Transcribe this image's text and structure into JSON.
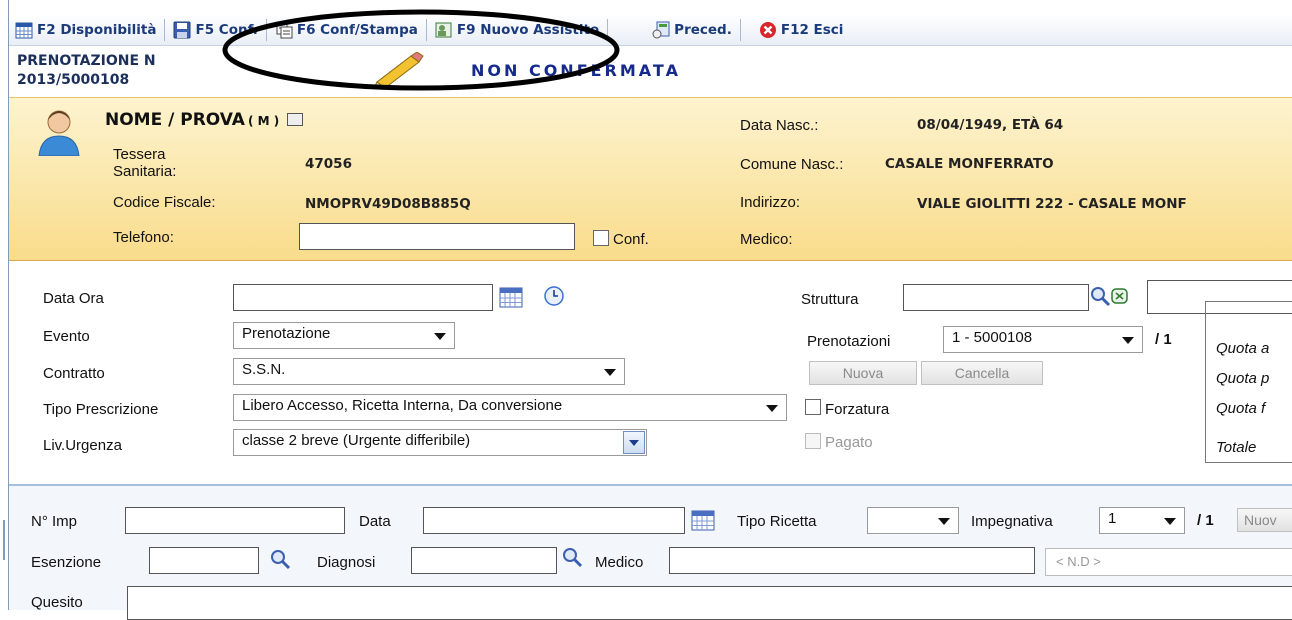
{
  "toolbar": {
    "disponibilita": "F2 Disponibilità",
    "conf": "F5 Conf.",
    "conf_stampa": "F6 Conf/Stampa",
    "nuovo_assistito": "F9 Nuovo Assistito",
    "preced": "Preced.",
    "esci": "F12 Esci"
  },
  "header": {
    "prenotazione_label": "PRENOTAZIONE N",
    "prenotazione_num": "2013/5000108",
    "stato": "NON CONFERMATA"
  },
  "patient": {
    "name": "NOME / PROVA",
    "sex": "( M )",
    "tessera_label_1": "Tessera",
    "tessera_label_2": "Sanitaria:",
    "tessera_value": "47056",
    "cf_label": "Codice Fiscale:",
    "cf_value": "NMOPRV49D08B885Q",
    "telefono_label": "Telefono:",
    "telefono_value": "",
    "conf_label": "Conf.",
    "data_nasc_label": "Data Nasc.:",
    "data_nasc_value": "08/04/1949, ETÀ 64",
    "comune_label": "Comune Nasc.:",
    "comune_value": "CASALE MONFERRATO",
    "indirizzo_label": "Indirizzo:",
    "indirizzo_value": "VIALE GIOLITTI 222  -  CASALE MONF",
    "medico_label": "Medico:"
  },
  "form": {
    "data_ora_label": "Data Ora",
    "data_ora_value": "",
    "evento_label": "Evento",
    "evento_value": "Prenotazione",
    "contratto_label": "Contratto",
    "contratto_value": "S.S.N.",
    "tipo_prescr_label": "Tipo Prescrizione",
    "tipo_prescr_value": "Libero Accesso, Ricetta Interna, Da conversione",
    "urgenza_label": "Liv.Urgenza",
    "urgenza_value": "classe 2 breve (Urgente differibile)",
    "struttura_label": "Struttura",
    "prenotazioni_label": "Prenotazioni",
    "prenotazioni_value": "1 - 5000108",
    "prenotazioni_total": "/ 1",
    "nuova_label": "Nuova",
    "cancella_label": "Cancella",
    "forzatura_label": "Forzatura",
    "pagato_label": "Pagato",
    "quota1": "Quota a",
    "quota2": "Quota p",
    "quota3": "Quota f",
    "totale": "Totale"
  },
  "impegnativa": {
    "nimp_label": "N° Imp",
    "data_label": "Data",
    "tipo_ricetta_label": "Tipo Ricetta",
    "impegnativa_label": "Impegnativa",
    "impegnativa_value": "1",
    "impegnativa_total": "/ 1",
    "nuova_short": "Nuov",
    "esenzione_label": "Esenzione",
    "diagnosi_label": "Diagnosi",
    "medico_label": "Medico",
    "medico_nd": "< N.D >",
    "quesito_label": "Quesito"
  }
}
